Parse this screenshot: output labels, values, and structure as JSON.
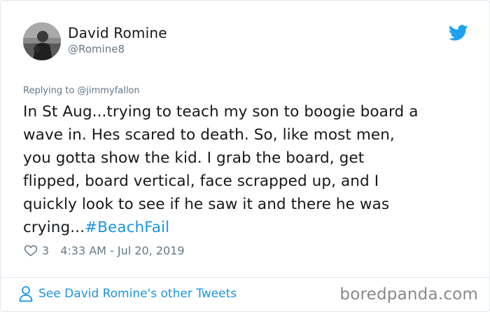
{
  "author": {
    "name": "David Romine",
    "handle": "@Romine8"
  },
  "reply_context": "Replying to @jimmyfallon",
  "tweet": {
    "lines": [
      "In St Aug...trying to teach my son to boogie board a",
      "wave in. Hes scared to death. So, like most men,",
      "you gotta show the kid. I grab the board, get",
      "flipped, board vertical, face scrapped up, and I",
      "quickly look to see if he saw it and there he was"
    ],
    "last_line_text": "crying...",
    "hashtag": "#BeachFail"
  },
  "meta": {
    "likes": "3",
    "timestamp": "4:33 AM - Jul 20, 2019"
  },
  "footer": {
    "link_label": "See David Romine's other Tweets",
    "watermark": "boredpanda.com"
  },
  "colors": {
    "accent": "#1b95e0",
    "muted": "#657786",
    "text": "#14171a",
    "twitter_blue": "#1da1f2"
  },
  "icons": {
    "brand": "twitter-bird-icon",
    "like": "heart-icon",
    "profile": "person-icon"
  }
}
